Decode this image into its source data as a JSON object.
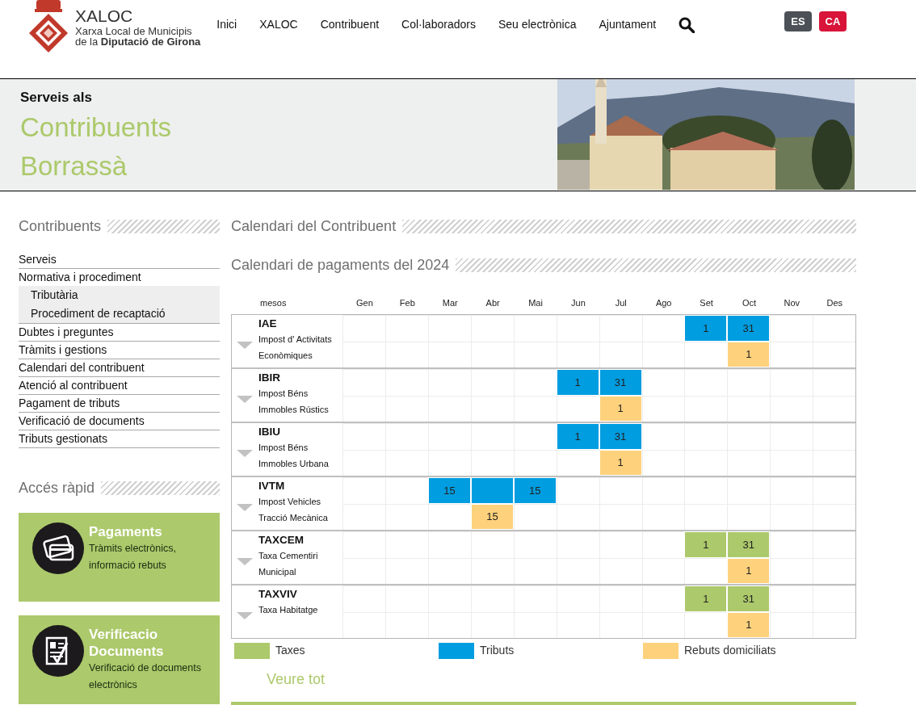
{
  "header": {
    "logo_title": "XALOC",
    "logo_line_1": "Xarxa Local de Municipis",
    "logo_line_2": "de la **Diputació de Girona**",
    "nav": [
      "Inici",
      "XALOC",
      "Contribuent",
      "Col·laboradors",
      "Seu electrònica",
      "Ajuntament"
    ],
    "languages": [
      {
        "label": "ES",
        "selected": false
      },
      {
        "label": "CA",
        "selected": true
      }
    ]
  },
  "banner": {
    "kicker": "Serveis als",
    "title_1": "Contribuents",
    "title_2": "Borrassà"
  },
  "sidebar": {
    "heading": "Contribuents",
    "items": [
      {
        "label": "Serveis"
      },
      {
        "label": "Normativa i procediment",
        "children": [
          {
            "label": "Tributària"
          },
          {
            "label": "Procediment de recaptació"
          }
        ]
      },
      {
        "label": "Dubtes i preguntes"
      },
      {
        "label": "Tràmits i gestions"
      },
      {
        "label": "Calendari del contribuent"
      },
      {
        "label": "Atenció al contribuent"
      },
      {
        "label": "Pagament de tributs"
      },
      {
        "label": "Verificació de documents"
      },
      {
        "label": "Tributs gestionats"
      }
    ],
    "quick_heading": "Accés ràpid",
    "quick_links": [
      {
        "kind": "card",
        "title": "Pagaments",
        "text": "Tràmits electrònics, informació rebuts"
      },
      {
        "kind": "check",
        "title": "Verificacio Documents",
        "text": "Verificació de documents electrònics"
      }
    ]
  },
  "main": {
    "heading": "Calendari del Contribuent",
    "calendar_heading": "Calendari de pagaments del 2024",
    "label_header": "mesos",
    "months": [
      "Gen",
      "Feb",
      "Mar",
      "Abr",
      "Mai",
      "Jun",
      "Jul",
      "Ago",
      "Set",
      "Oct",
      "Nov",
      "Des"
    ],
    "taxes": [
      {
        "code": "IAE",
        "description_lines": [
          "Impost d' Activitats",
          "Econòmiques"
        ],
        "rows": [
          {
            "cells": [
              {
                "kind": "empty"
              },
              {
                "kind": "empty"
              },
              {
                "kind": "empty"
              },
              {
                "kind": "empty"
              },
              {
                "kind": "empty"
              },
              {
                "kind": "empty"
              },
              {
                "kind": "empty"
              },
              {
                "kind": "empty"
              },
              {
                "kind": "tributs",
                "text": "1"
              },
              {
                "kind": "tributs",
                "text": "31"
              },
              {
                "kind": "empty"
              },
              {
                "kind": "empty"
              }
            ]
          },
          {
            "cells": [
              {
                "kind": "empty"
              },
              {
                "kind": "empty"
              },
              {
                "kind": "empty"
              },
              {
                "kind": "empty"
              },
              {
                "kind": "empty"
              },
              {
                "kind": "empty"
              },
              {
                "kind": "empty"
              },
              {
                "kind": "empty"
              },
              {
                "kind": "empty"
              },
              {
                "kind": "rebuts",
                "text": "1"
              },
              {
                "kind": "empty"
              },
              {
                "kind": "empty"
              }
            ]
          }
        ]
      },
      {
        "code": "IBIR",
        "description_lines": [
          "Impost Béns",
          "Immobles Rústics"
        ],
        "rows": [
          {
            "cells": [
              {
                "kind": "empty"
              },
              {
                "kind": "empty"
              },
              {
                "kind": "empty"
              },
              {
                "kind": "empty"
              },
              {
                "kind": "empty"
              },
              {
                "kind": "tributs",
                "text": "1"
              },
              {
                "kind": "tributs",
                "text": "31"
              },
              {
                "kind": "empty"
              },
              {
                "kind": "empty"
              },
              {
                "kind": "empty"
              },
              {
                "kind": "empty"
              },
              {
                "kind": "empty"
              }
            ]
          },
          {
            "cells": [
              {
                "kind": "empty"
              },
              {
                "kind": "empty"
              },
              {
                "kind": "empty"
              },
              {
                "kind": "empty"
              },
              {
                "kind": "empty"
              },
              {
                "kind": "empty"
              },
              {
                "kind": "rebuts",
                "text": "1"
              },
              {
                "kind": "empty"
              },
              {
                "kind": "empty"
              },
              {
                "kind": "empty"
              },
              {
                "kind": "empty"
              },
              {
                "kind": "empty"
              }
            ]
          }
        ]
      },
      {
        "code": "IBIU",
        "description_lines": [
          "Impost Béns",
          "Immobles Urbana"
        ],
        "rows": [
          {
            "cells": [
              {
                "kind": "empty"
              },
              {
                "kind": "empty"
              },
              {
                "kind": "empty"
              },
              {
                "kind": "empty"
              },
              {
                "kind": "empty"
              },
              {
                "kind": "tributs",
                "text": "1"
              },
              {
                "kind": "tributs",
                "text": "31"
              },
              {
                "kind": "empty"
              },
              {
                "kind": "empty"
              },
              {
                "kind": "empty"
              },
              {
                "kind": "empty"
              },
              {
                "kind": "empty"
              }
            ]
          },
          {
            "cells": [
              {
                "kind": "empty"
              },
              {
                "kind": "empty"
              },
              {
                "kind": "empty"
              },
              {
                "kind": "empty"
              },
              {
                "kind": "empty"
              },
              {
                "kind": "empty"
              },
              {
                "kind": "rebuts",
                "text": "1"
              },
              {
                "kind": "empty"
              },
              {
                "kind": "empty"
              },
              {
                "kind": "empty"
              },
              {
                "kind": "empty"
              },
              {
                "kind": "empty"
              }
            ]
          }
        ]
      },
      {
        "code": "IVTM",
        "description_lines": [
          "Impost Vehicles",
          "Tracció Mecànica"
        ],
        "rows": [
          {
            "cells": [
              {
                "kind": "empty"
              },
              {
                "kind": "empty"
              },
              {
                "kind": "tributs",
                "text": "15"
              },
              {
                "kind": "tributs"
              },
              {
                "kind": "tributs",
                "text": "15"
              },
              {
                "kind": "empty"
              },
              {
                "kind": "empty"
              },
              {
                "kind": "empty"
              },
              {
                "kind": "empty"
              },
              {
                "kind": "empty"
              },
              {
                "kind": "empty"
              },
              {
                "kind": "empty"
              }
            ]
          },
          {
            "cells": [
              {
                "kind": "empty"
              },
              {
                "kind": "empty"
              },
              {
                "kind": "empty"
              },
              {
                "kind": "rebuts",
                "text": "15"
              },
              {
                "kind": "empty"
              },
              {
                "kind": "empty"
              },
              {
                "kind": "empty"
              },
              {
                "kind": "empty"
              },
              {
                "kind": "empty"
              },
              {
                "kind": "empty"
              },
              {
                "kind": "empty"
              },
              {
                "kind": "empty"
              }
            ]
          }
        ]
      },
      {
        "code": "TAXCEM",
        "description_lines": [
          "Taxa Cementiri",
          "Municipal"
        ],
        "rows": [
          {
            "cells": [
              {
                "kind": "empty"
              },
              {
                "kind": "empty"
              },
              {
                "kind": "empty"
              },
              {
                "kind": "empty"
              },
              {
                "kind": "empty"
              },
              {
                "kind": "empty"
              },
              {
                "kind": "empty"
              },
              {
                "kind": "empty"
              },
              {
                "kind": "taxes",
                "text": "1"
              },
              {
                "kind": "taxes",
                "text": "31"
              },
              {
                "kind": "empty"
              },
              {
                "kind": "empty"
              }
            ]
          },
          {
            "cells": [
              {
                "kind": "empty"
              },
              {
                "kind": "empty"
              },
              {
                "kind": "empty"
              },
              {
                "kind": "empty"
              },
              {
                "kind": "empty"
              },
              {
                "kind": "empty"
              },
              {
                "kind": "empty"
              },
              {
                "kind": "empty"
              },
              {
                "kind": "empty"
              },
              {
                "kind": "rebuts",
                "text": "1"
              },
              {
                "kind": "empty"
              },
              {
                "kind": "empty"
              }
            ]
          }
        ]
      },
      {
        "code": "TAXVIV",
        "description_lines": [
          "Taxa Habitatge"
        ],
        "rows": [
          {
            "cells": [
              {
                "kind": "empty"
              },
              {
                "kind": "empty"
              },
              {
                "kind": "empty"
              },
              {
                "kind": "empty"
              },
              {
                "kind": "empty"
              },
              {
                "kind": "empty"
              },
              {
                "kind": "empty"
              },
              {
                "kind": "empty"
              },
              {
                "kind": "taxes",
                "text": "1"
              },
              {
                "kind": "taxes",
                "text": "31"
              },
              {
                "kind": "empty"
              },
              {
                "kind": "empty"
              }
            ]
          },
          {
            "cells": [
              {
                "kind": "empty"
              },
              {
                "kind": "empty"
              },
              {
                "kind": "empty"
              },
              {
                "kind": "empty"
              },
              {
                "kind": "empty"
              },
              {
                "kind": "empty"
              },
              {
                "kind": "empty"
              },
              {
                "kind": "empty"
              },
              {
                "kind": "empty"
              },
              {
                "kind": "rebuts",
                "text": "1"
              },
              {
                "kind": "empty"
              },
              {
                "kind": "empty"
              }
            ]
          }
        ]
      }
    ],
    "legend": [
      {
        "kind": "taxes",
        "label": "Taxes"
      },
      {
        "kind": "tributs",
        "label": "Tributs"
      },
      {
        "kind": "rebuts",
        "label": "Rebuts domiciliats"
      }
    ],
    "more_link": "Veure tot"
  }
}
